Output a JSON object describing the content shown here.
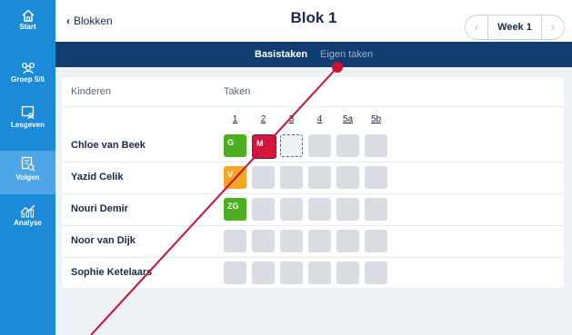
{
  "sidebar": {
    "items": [
      {
        "label": "Start",
        "icon": "home-icon"
      },
      {
        "label": "Groep 5/6",
        "icon": "group-icon"
      },
      {
        "label": "Lesgeven",
        "icon": "teach-icon"
      },
      {
        "label": "Volgen",
        "icon": "track-icon"
      },
      {
        "label": "Analyse",
        "icon": "analysis-icon"
      }
    ],
    "active_item": "Volgen"
  },
  "header": {
    "back_label": "Blokken",
    "title": "Blok 1",
    "week_label": "Week 1"
  },
  "subnav": {
    "tabs": [
      "Basistaken",
      "Eigen taken"
    ],
    "active_tab": "Basistaken"
  },
  "table": {
    "col_children": "Kinderen",
    "col_tasks": "Taken",
    "levels": [
      "1",
      "2",
      "3",
      "4",
      "5a",
      "5b"
    ],
    "rows": [
      {
        "name": "Chloe van Beek",
        "cells": [
          {
            "label": "G",
            "status": "green"
          },
          {
            "label": "M",
            "status": "red"
          },
          {
            "label": "",
            "status": "dashed"
          },
          {
            "label": "",
            "status": "empty"
          },
          {
            "label": "",
            "status": "empty"
          },
          {
            "label": "",
            "status": "empty"
          }
        ]
      },
      {
        "name": "Yazid Celik",
        "cells": [
          {
            "label": "V",
            "status": "orange"
          },
          {
            "label": "",
            "status": "empty"
          },
          {
            "label": "",
            "status": "empty"
          },
          {
            "label": "",
            "status": "empty"
          },
          {
            "label": "",
            "status": "empty"
          },
          {
            "label": "",
            "status": "empty"
          }
        ]
      },
      {
        "name": "Nouri Demir",
        "cells": [
          {
            "label": "ZG",
            "status": "green"
          },
          {
            "label": "",
            "status": "empty"
          },
          {
            "label": "",
            "status": "empty"
          },
          {
            "label": "",
            "status": "empty"
          },
          {
            "label": "",
            "status": "empty"
          },
          {
            "label": "",
            "status": "empty"
          }
        ]
      },
      {
        "name": "Noor van Dijk",
        "cells": [
          {
            "label": "",
            "status": "empty"
          },
          {
            "label": "",
            "status": "empty"
          },
          {
            "label": "",
            "status": "empty"
          },
          {
            "label": "",
            "status": "empty"
          },
          {
            "label": "",
            "status": "empty"
          },
          {
            "label": "",
            "status": "empty"
          }
        ]
      },
      {
        "name": "Sophie Ketelaars",
        "cells": [
          {
            "label": "",
            "status": "empty"
          },
          {
            "label": "",
            "status": "empty"
          },
          {
            "label": "",
            "status": "empty"
          },
          {
            "label": "",
            "status": "empty"
          },
          {
            "label": "",
            "status": "empty"
          },
          {
            "label": "",
            "status": "empty"
          }
        ]
      }
    ]
  },
  "colors": {
    "sidebar": "#1b8bd8",
    "subnav": "#0f3d72",
    "green": "#4caf1f",
    "orange": "#f5a623",
    "red": "#d6163c",
    "annotation": "#cc1133"
  }
}
